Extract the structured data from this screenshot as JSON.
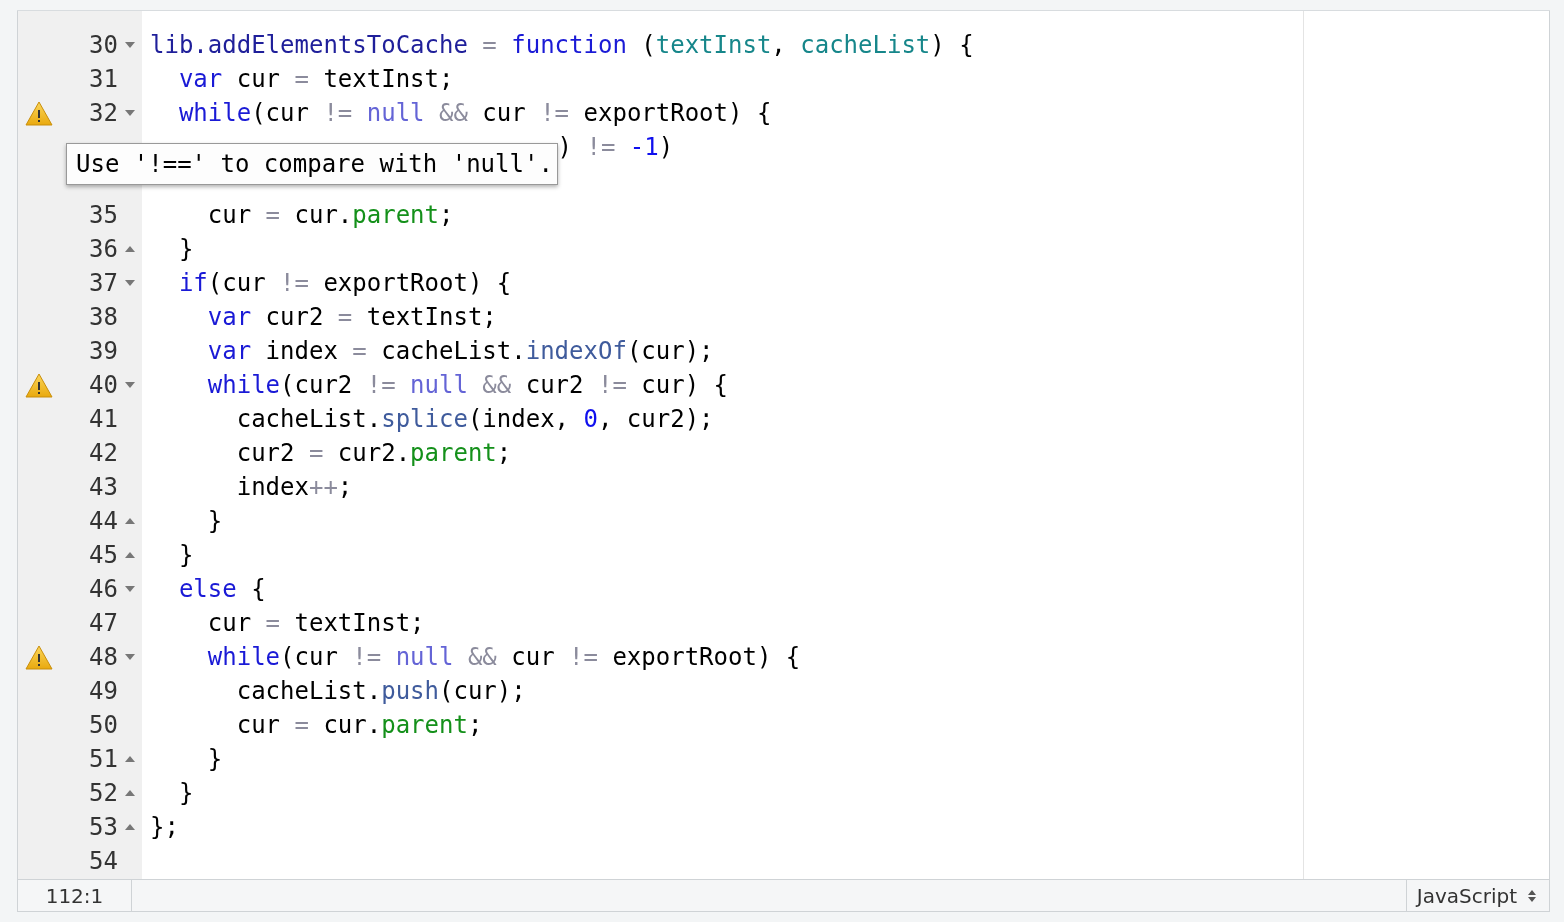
{
  "editor": {
    "lines": [
      {
        "number": "30",
        "kind": "block-start",
        "warning": false,
        "code": [
          {
            "text": "lib.addElementsToCache",
            "kind": "def"
          },
          {
            "text": " = ",
            "kind": "op"
          },
          {
            "text": "function",
            "kind": "kw"
          },
          {
            "text": " (",
            "kind": "plain"
          },
          {
            "text": "textInst",
            "kind": "param"
          },
          {
            "text": ", ",
            "kind": "plain"
          },
          {
            "text": "cacheList",
            "kind": "param"
          },
          {
            "text": ") {",
            "kind": "plain"
          }
        ]
      },
      {
        "number": "31",
        "kind": "plain",
        "warning": false,
        "code": [
          {
            "text": "  var",
            "kind": "kw"
          },
          {
            "text": " cur ",
            "kind": "plain"
          },
          {
            "text": "=",
            "kind": "op"
          },
          {
            "text": " textInst;",
            "kind": "plain"
          }
        ]
      },
      {
        "number": "32",
        "kind": "block-start",
        "warning": true,
        "code": [
          {
            "text": "  while",
            "kind": "kw"
          },
          {
            "text": "(cur ",
            "kind": "plain"
          },
          {
            "text": "!=",
            "kind": "op"
          },
          {
            "text": " null ",
            "kind": "atom"
          },
          {
            "text": "&&",
            "kind": "op"
          },
          {
            "text": " cur ",
            "kind": "plain"
          },
          {
            "text": "!=",
            "kind": "op"
          },
          {
            "text": " exportRoot) {",
            "kind": "plain"
          }
        ]
      },
      {
        "kind": "plain",
        "warning": false,
        "code": [
          {
            "text": ") ",
            "kind": "plain"
          },
          {
            "text": "!= ",
            "kind": "op"
          },
          {
            "text": "-1",
            "kind": "num"
          },
          {
            "text": ")",
            "kind": "plain"
          }
        ]
      },
      {
        "kind": "plain",
        "warning": false
      },
      {
        "number": "35",
        "kind": "plain",
        "warning": false,
        "code": [
          {
            "text": "    cur ",
            "kind": "plain"
          },
          {
            "text": "=",
            "kind": "op"
          },
          {
            "text": " cur.",
            "kind": "plain"
          },
          {
            "text": "parent",
            "kind": "prop"
          },
          {
            "text": ";",
            "kind": "plain"
          }
        ]
      },
      {
        "number": "36",
        "kind": "block-end",
        "warning": false,
        "code": [
          {
            "text": "  }",
            "kind": "plain"
          }
        ]
      },
      {
        "number": "37",
        "kind": "block-start",
        "warning": false,
        "code": [
          {
            "text": "  if",
            "kind": "kw"
          },
          {
            "text": "(cur ",
            "kind": "plain"
          },
          {
            "text": "!=",
            "kind": "op"
          },
          {
            "text": " exportRoot) {",
            "kind": "plain"
          }
        ]
      },
      {
        "number": "38",
        "kind": "plain",
        "warning": false,
        "code": [
          {
            "text": "    var",
            "kind": "kw"
          },
          {
            "text": " cur2 ",
            "kind": "plain"
          },
          {
            "text": "=",
            "kind": "op"
          },
          {
            "text": " textInst;",
            "kind": "plain"
          }
        ]
      },
      {
        "number": "39",
        "kind": "plain",
        "warning": false,
        "code": [
          {
            "text": "    var",
            "kind": "kw"
          },
          {
            "text": " index ",
            "kind": "plain"
          },
          {
            "text": "=",
            "kind": "op"
          },
          {
            "text": " cacheList.",
            "kind": "plain"
          },
          {
            "text": "indexOf",
            "kind": "method"
          },
          {
            "text": "(cur);",
            "kind": "plain"
          }
        ]
      },
      {
        "number": "40",
        "kind": "block-start",
        "warning": true,
        "code": [
          {
            "text": "    while",
            "kind": "kw"
          },
          {
            "text": "(cur2 ",
            "kind": "plain"
          },
          {
            "text": "!=",
            "kind": "op"
          },
          {
            "text": " null ",
            "kind": "atom"
          },
          {
            "text": "&&",
            "kind": "op"
          },
          {
            "text": " cur2 ",
            "kind": "plain"
          },
          {
            "text": "!=",
            "kind": "op"
          },
          {
            "text": " cur) {",
            "kind": "plain"
          }
        ]
      },
      {
        "number": "41",
        "kind": "plain",
        "warning": false,
        "code": [
          {
            "text": "      cacheList.",
            "kind": "plain"
          },
          {
            "text": "splice",
            "kind": "method"
          },
          {
            "text": "(index, ",
            "kind": "plain"
          },
          {
            "text": "0",
            "kind": "num"
          },
          {
            "text": ", cur2);",
            "kind": "plain"
          }
        ]
      },
      {
        "number": "42",
        "kind": "plain",
        "warning": false,
        "code": [
          {
            "text": "      cur2 ",
            "kind": "plain"
          },
          {
            "text": "=",
            "kind": "op"
          },
          {
            "text": " cur2.",
            "kind": "plain"
          },
          {
            "text": "parent",
            "kind": "prop"
          },
          {
            "text": ";",
            "kind": "plain"
          }
        ]
      },
      {
        "number": "43",
        "kind": "plain",
        "warning": false,
        "code": [
          {
            "text": "      index",
            "kind": "plain"
          },
          {
            "text": "++",
            "kind": "op"
          },
          {
            "text": ";",
            "kind": "plain"
          }
        ]
      },
      {
        "number": "44",
        "kind": "block-end",
        "warning": false,
        "code": [
          {
            "text": "    }",
            "kind": "plain"
          }
        ]
      },
      {
        "number": "45",
        "kind": "block-end",
        "warning": false,
        "code": [
          {
            "text": "  }",
            "kind": "plain"
          }
        ]
      },
      {
        "number": "46",
        "kind": "block-start",
        "warning": false,
        "code": [
          {
            "text": "  else",
            "kind": "kw"
          },
          {
            "text": " {",
            "kind": "plain"
          }
        ]
      },
      {
        "number": "47",
        "kind": "plain",
        "warning": false,
        "code": [
          {
            "text": "    cur ",
            "kind": "plain"
          },
          {
            "text": "=",
            "kind": "op"
          },
          {
            "text": " textInst;",
            "kind": "plain"
          }
        ]
      },
      {
        "number": "48",
        "kind": "block-start",
        "warning": true,
        "code": [
          {
            "text": "    while",
            "kind": "kw"
          },
          {
            "text": "(cur ",
            "kind": "plain"
          },
          {
            "text": "!=",
            "kind": "op"
          },
          {
            "text": " null ",
            "kind": "atom"
          },
          {
            "text": "&&",
            "kind": "op"
          },
          {
            "text": " cur ",
            "kind": "plain"
          },
          {
            "text": "!=",
            "kind": "op"
          },
          {
            "text": " exportRoot) {",
            "kind": "plain"
          }
        ]
      },
      {
        "number": "49",
        "kind": "plain",
        "warning": false,
        "code": [
          {
            "text": "      cacheList.",
            "kind": "plain"
          },
          {
            "text": "push",
            "kind": "method"
          },
          {
            "text": "(cur);",
            "kind": "plain"
          }
        ]
      },
      {
        "number": "50",
        "kind": "plain",
        "warning": false,
        "code": [
          {
            "text": "      cur ",
            "kind": "plain"
          },
          {
            "text": "=",
            "kind": "op"
          },
          {
            "text": " cur.",
            "kind": "plain"
          },
          {
            "text": "parent",
            "kind": "prop"
          },
          {
            "text": ";",
            "kind": "plain"
          }
        ]
      },
      {
        "number": "51",
        "kind": "block-end",
        "warning": false,
        "code": [
          {
            "text": "    }",
            "kind": "plain"
          }
        ]
      },
      {
        "number": "52",
        "kind": "block-end",
        "warning": false,
        "code": [
          {
            "text": "  }",
            "kind": "plain"
          }
        ]
      },
      {
        "number": "53",
        "kind": "block-end",
        "warning": false,
        "code": [
          {
            "text": "};",
            "kind": "plain"
          }
        ]
      },
      {
        "number": "54",
        "kind": "plain",
        "warning": false
      }
    ],
    "tooltip": "Use '!==' to compare with 'null'."
  },
  "status_bar": {
    "position": "112:1",
    "language": "JavaScript"
  }
}
